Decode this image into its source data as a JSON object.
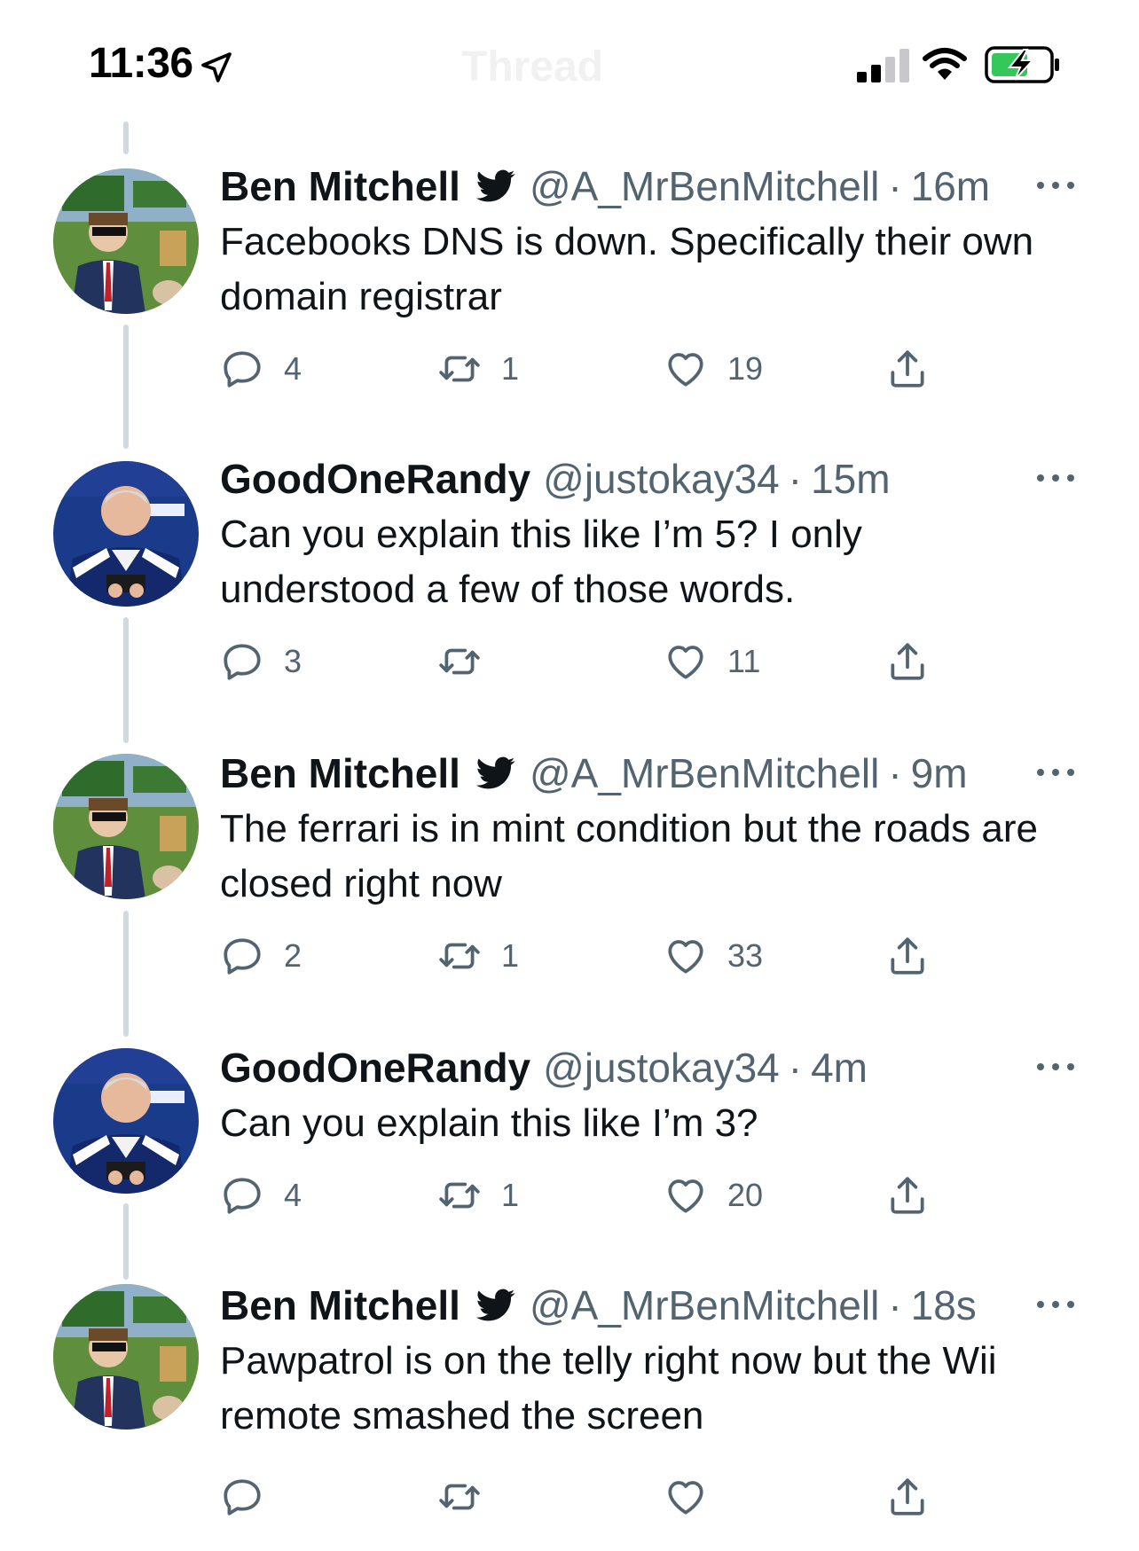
{
  "status_bar": {
    "time": "11:36",
    "nav_title": "Thread"
  },
  "colors": {
    "text_primary": "#0f1419",
    "text_secondary": "#536471",
    "thread_line": "#cfd9de",
    "battery_charge": "#34c759"
  },
  "icons": {
    "location": "location-arrow-icon",
    "signal": "cellular-signal-icon",
    "wifi": "wifi-icon",
    "battery": "battery-charging-icon",
    "verified": "twitter-bird-icon",
    "more": "more-options-icon",
    "reply": "reply-icon",
    "retweet": "retweet-icon",
    "like": "heart-icon",
    "share": "share-icon"
  },
  "tweets": [
    {
      "name": "Ben Mitchell",
      "handle": "@A_MrBenMitchell",
      "dot": "·",
      "time": "16m",
      "text": "Facebooks DNS is down. Specifically their own domain registrar",
      "replies": "4",
      "retweets": "1",
      "likes": "19"
    },
    {
      "name": "GoodOneRandy",
      "handle": "@justokay34",
      "dot": "·",
      "time": "15m",
      "text": "Can you explain this like I’m 5? I only understood a few of those words.",
      "replies": "3",
      "retweets": "",
      "likes": "11"
    },
    {
      "name": "Ben Mitchell",
      "handle": "@A_MrBenMitchell",
      "dot": "·",
      "time": "9m",
      "text": "The ferrari is in mint condition but the roads are closed right now",
      "replies": "2",
      "retweets": "1",
      "likes": "33"
    },
    {
      "name": "GoodOneRandy",
      "handle": "@justokay34",
      "dot": "·",
      "time": "4m",
      "text": "Can you explain this like I’m 3?",
      "replies": "4",
      "retweets": "1",
      "likes": "20"
    },
    {
      "name": "Ben Mitchell",
      "handle": "@A_MrBenMitchell",
      "dot": "·",
      "time": "18s",
      "text": "Pawpatrol is on the telly right now but the Wii remote smashed the screen",
      "replies": "",
      "retweets": "",
      "likes": ""
    }
  ]
}
